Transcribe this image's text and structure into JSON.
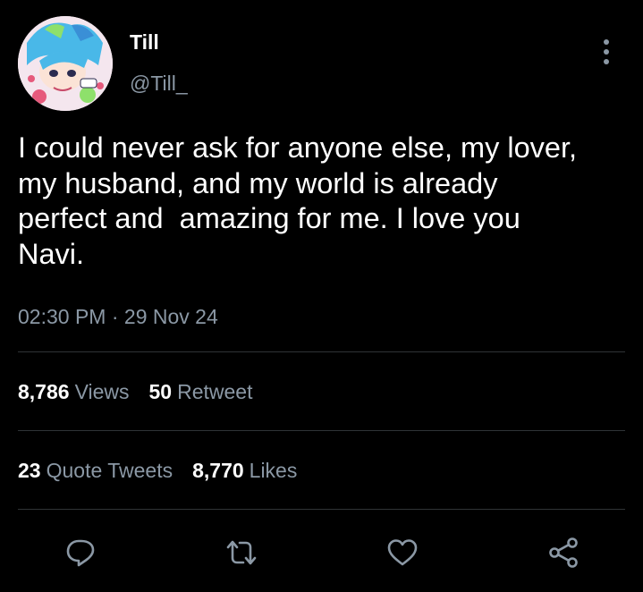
{
  "author": {
    "display_name": "Till",
    "handle": "@Till_"
  },
  "tweet": {
    "text": "I could never ask for anyone else, my lover,\nmy husband, and my world is already\nperfect and  amazing for me. I love you\nNavi.",
    "time": "02:30 PM",
    "separator": " · ",
    "date": "29 Nov 24"
  },
  "stats": {
    "views_count": "8,786",
    "views_label": "Views",
    "retweet_count": "50",
    "retweet_label": "Retweet",
    "quote_count": "23",
    "quote_label": "Quote Tweets",
    "likes_count": "8,770",
    "likes_label": "Likes"
  },
  "actions": [
    "reply-icon",
    "retweet-icon",
    "like-icon",
    "share-icon"
  ],
  "colors": {
    "background": "#000000",
    "text_primary": "#ffffff",
    "text_secondary": "#8b98a5",
    "divider": "#2f3336",
    "icon": "#8b98a5"
  }
}
